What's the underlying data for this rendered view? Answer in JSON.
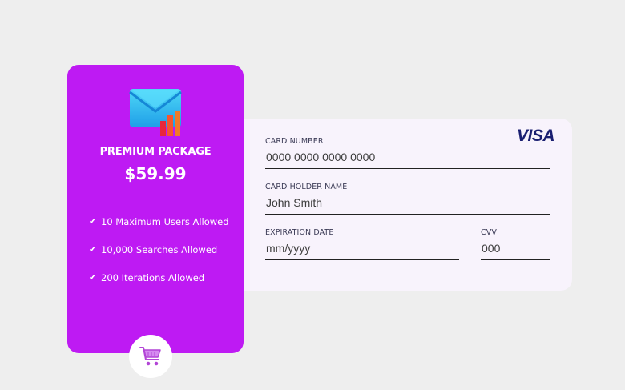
{
  "package": {
    "name": "PREMIUM PACKAGE",
    "price": "$59.99",
    "icon": "mail-chart-icon",
    "features": [
      "10 Maximum Users Allowed",
      "10,000 Searches Allowed",
      "200 Iterations Allowed"
    ],
    "accent_color": "#be1af3"
  },
  "payment": {
    "brand": "VISA",
    "card_number": {
      "label": "CARD NUMBER",
      "placeholder": "0000 0000 0000 0000"
    },
    "holder_name": {
      "label": "CARD HOLDER NAME",
      "placeholder": "John Smith"
    },
    "expiration": {
      "label": "EXPIRATION DATE",
      "placeholder": "mm/yyyy"
    },
    "cvv": {
      "label": "CVV",
      "placeholder": "000"
    }
  },
  "cart": {
    "icon": "shopping-cart-icon"
  }
}
